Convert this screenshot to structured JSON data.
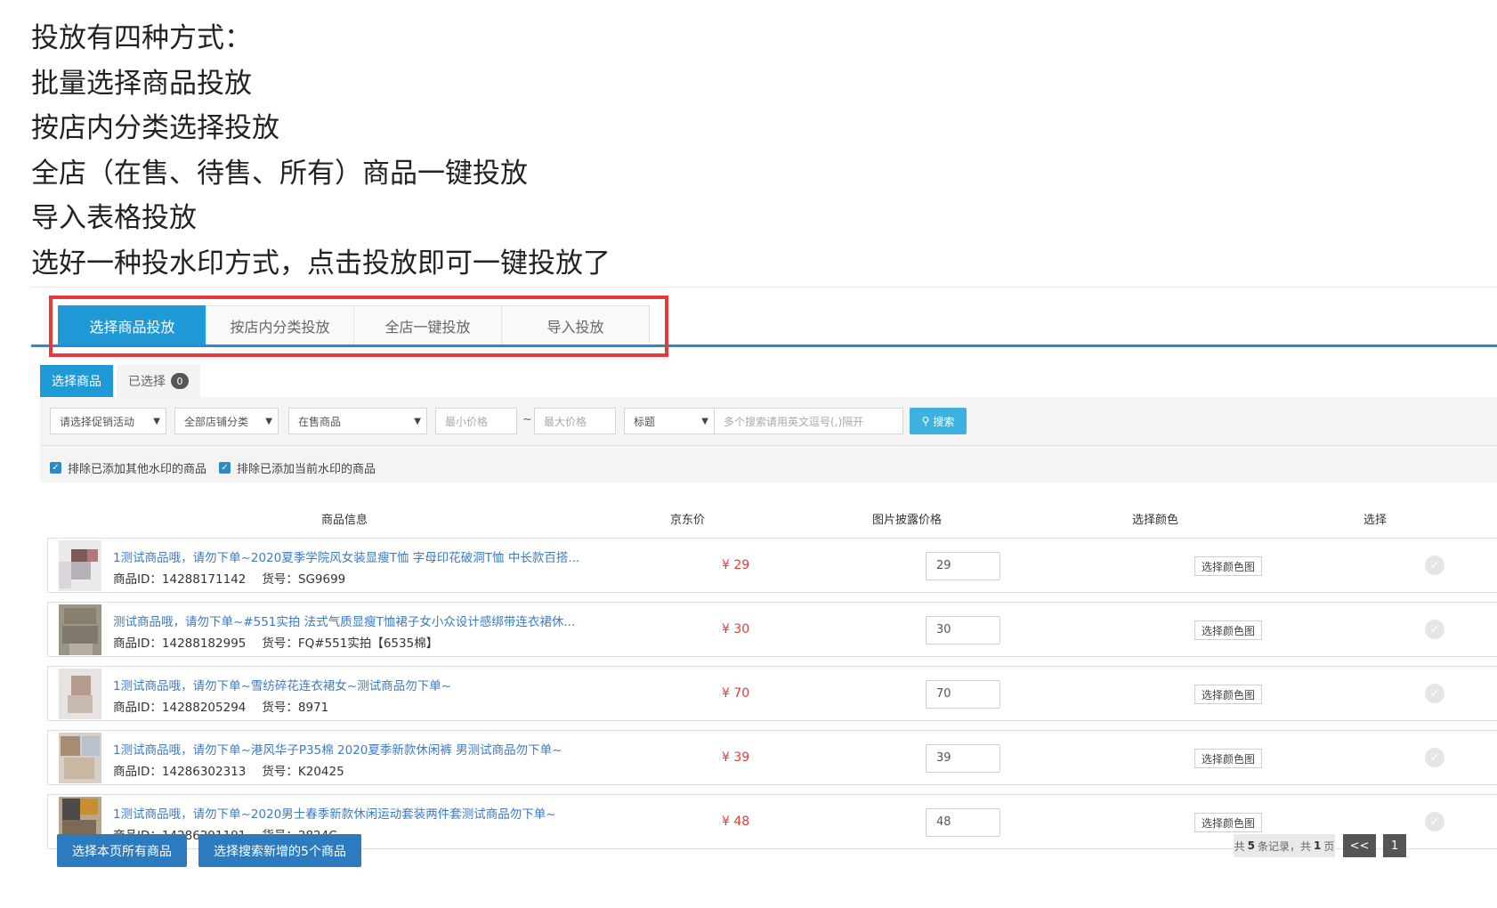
{
  "intro": {
    "lines": [
      "投放有四种方式：",
      "批量选择商品投放",
      "按店内分类选择投放",
      "全店（在售、待售、所有）商品一键投放",
      "导入表格投放",
      "选好一种投水印方式，点击投放即可一键投放了"
    ]
  },
  "tabs": [
    {
      "label": "选择商品投放",
      "active": true
    },
    {
      "label": "按店内分类投放",
      "active": false
    },
    {
      "label": "全店一键投放",
      "active": false
    },
    {
      "label": "导入投放",
      "active": false
    }
  ],
  "subtabs": {
    "select_goods": "选择商品",
    "selected": "已选择",
    "selected_count": "0"
  },
  "filters": {
    "promotion": "请选择促销活动",
    "category": "全部店铺分类",
    "status": "在售商品",
    "min_price_placeholder": "最小价格",
    "range_sep": "~",
    "max_price_placeholder": "最大价格",
    "field": "标题",
    "search_placeholder": "多个搜索请用英文逗号(,)隔开",
    "search_button": "搜索"
  },
  "checkboxes": {
    "exclude_other": "排除已添加其他水印的商品",
    "exclude_current": "排除已添加当前水印的商品"
  },
  "table": {
    "headers": {
      "info": "商品信息",
      "jd_price": "京东价",
      "image_price": "图片披露价格",
      "color": "选择颜色",
      "select": "选择"
    },
    "id_label": "商品ID：",
    "sku_label": "货号：",
    "color_button": "选择颜色图",
    "rows": [
      {
        "title": "1测试商品哦，请勿下单~2020夏季学院风女装显瘦T恤 字母印花破洞T恤 中长款百搭...",
        "id": "14288171142",
        "sku": "SG9699",
        "price": "¥ 29",
        "image_price": "29"
      },
      {
        "title": "测试商品哦，请勿下单~#551实拍 法式气质显瘦T恤裙子女小众设计感绑带连衣裙休...",
        "id": "14288182995",
        "sku": "FQ#551实拍【6535棉】",
        "price": "¥ 30",
        "image_price": "30"
      },
      {
        "title": "1测试商品哦，请勿下单~雪纺碎花连衣裙女~测试商品勿下单~",
        "id": "14288205294",
        "sku": "8971",
        "price": "¥ 70",
        "image_price": "70"
      },
      {
        "title": "1测试商品哦，请勿下单~港风华子P35棉 2020夏季新款休闲裤 男测试商品勿下单~",
        "id": "14286302313",
        "sku": "K20425",
        "price": "¥ 39",
        "image_price": "39"
      },
      {
        "title": "1测试商品哦，请勿下单~2020男士春季新款休闲运动套装两件套测试商品勿下单~",
        "id": "14286291191",
        "sku": "2824C",
        "price": "¥ 48",
        "image_price": "48"
      }
    ]
  },
  "footer": {
    "select_page": "选择本页所有商品",
    "select_new": "选择搜索新增的5个商品",
    "pager_prefix": "共",
    "total_records": "5",
    "pager_mid": "条记录，共",
    "total_pages": "1",
    "pager_suffix": "页",
    "prev": "<<",
    "current_page": "1"
  },
  "colors": {
    "accent": "#1f9ad6",
    "highlight": "#e8383d",
    "price": "#e53935",
    "link": "#3b7bc4"
  }
}
